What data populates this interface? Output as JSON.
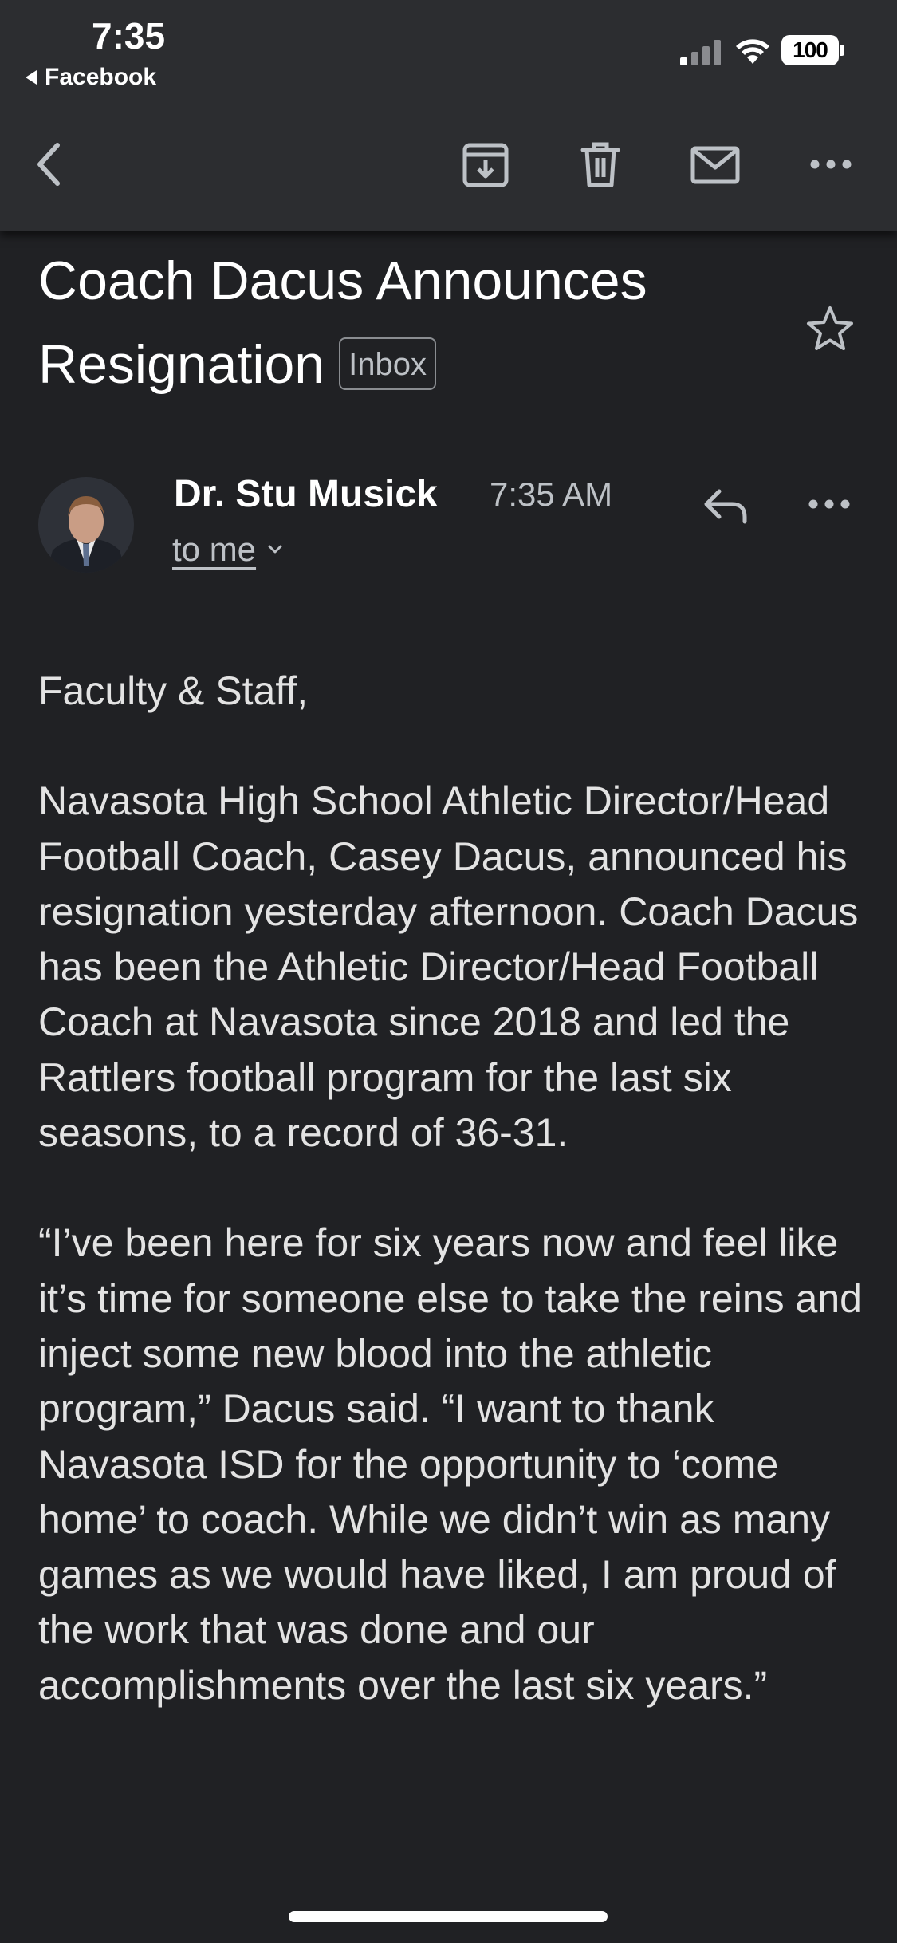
{
  "status_bar": {
    "time": "7:35",
    "back_app": "Facebook",
    "battery": "100"
  },
  "toolbar": {
    "icons": [
      "back-arrow-icon",
      "archive-icon",
      "trash-icon",
      "mail-icon",
      "more-icon"
    ]
  },
  "email": {
    "subject": "Coach Dacus Announces Resignation",
    "label": "Inbox",
    "sender": "Dr. Stu Musick",
    "time": "7:35 AM",
    "recipient": "to me",
    "body": [
      "Faculty & Staff,",
      "Navasota High School Athletic Director/Head Football Coach, Casey Dacus, announced his resignation yesterday afternoon.  Coach Dacus has been the Athletic Director/Head Football Coach at Navasota since 2018 and led the Rattlers football program for the last six seasons, to a record of 36-31.",
      "“I’ve been here for six years now and feel like it’s time for someone else to take the reins and inject some new blood into the athletic program,” Dacus said. “I want to thank Navasota ISD for the opportunity to ‘come home’ to coach. While we didn’t win as many games as we would have liked, I am proud of the work that was done and our accomplishments over the last six years.”"
    ]
  },
  "colors": {
    "background": "#202124",
    "toolbar": "#2c2d30",
    "text": "#e8eaed",
    "muted": "#bdc1c6"
  }
}
